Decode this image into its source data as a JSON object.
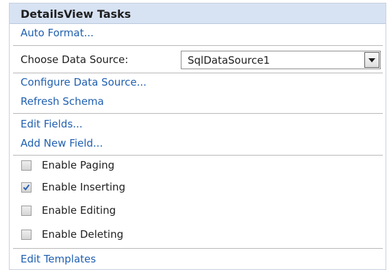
{
  "panel": {
    "title": "DetailsView Tasks"
  },
  "links": {
    "auto_format": "Auto Format...",
    "configure_data_source": "Configure Data Source...",
    "refresh_schema": "Refresh Schema",
    "edit_fields": "Edit Fields...",
    "add_new_field": "Add New Field...",
    "edit_templates": "Edit Templates"
  },
  "data_source": {
    "label": "Choose Data Source:",
    "selected": "SqlDataSource1"
  },
  "options": [
    {
      "label": "Enable Paging",
      "checked": false
    },
    {
      "label": "Enable Inserting",
      "checked": true
    },
    {
      "label": "Enable Editing",
      "checked": false
    },
    {
      "label": "Enable Deleting",
      "checked": false
    }
  ],
  "colors": {
    "link": "#1f5fb0",
    "header_bg": "#d7e2f3",
    "check_mark": "#2a5fb5"
  },
  "icons": {
    "dropdown": "chevron-down-icon",
    "check": "check-icon"
  }
}
